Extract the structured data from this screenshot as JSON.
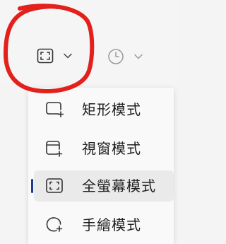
{
  "toolbar": {
    "capture_mode_button": {
      "icon": "fullscreen-capture-icon",
      "dropdown_icon": "chevron-down-icon"
    },
    "timer_button": {
      "icon": "clock-icon",
      "dropdown_icon": "chevron-down-icon"
    }
  },
  "annotation": {
    "shape": "hand-drawn-circle",
    "color": "#e3201b"
  },
  "menu": {
    "items": [
      {
        "label": "矩形模式",
        "icon": "rectangle-mode-icon",
        "selected": false
      },
      {
        "label": "視窗模式",
        "icon": "window-mode-icon",
        "selected": false
      },
      {
        "label": "全螢幕模式",
        "icon": "fullscreen-mode-icon",
        "selected": true
      },
      {
        "label": "手繪模式",
        "icon": "freeform-mode-icon",
        "selected": false
      }
    ]
  },
  "colors": {
    "selection_accent": "#1a3d8f",
    "text": "#1f1f1f",
    "icon": "#333333"
  }
}
